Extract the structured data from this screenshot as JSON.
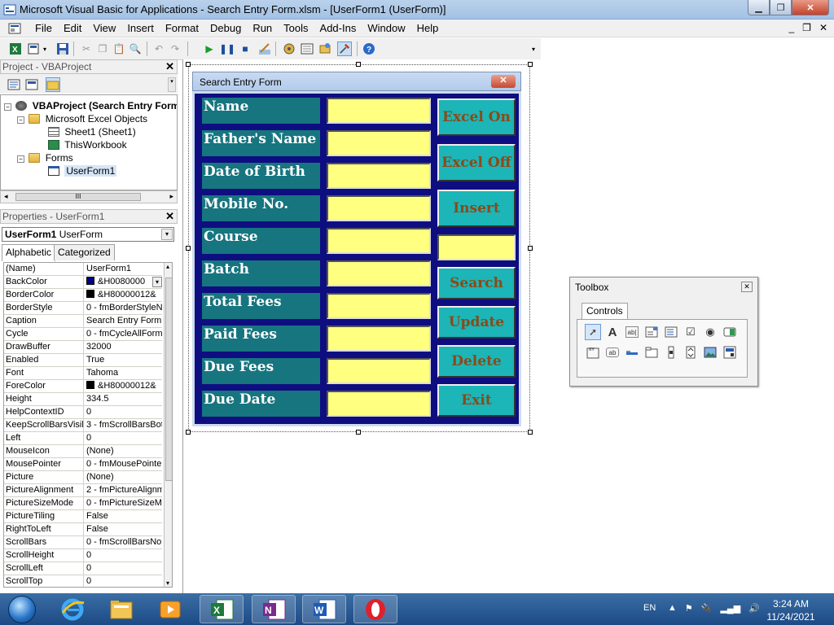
{
  "window": {
    "title": "Microsoft Visual Basic for Applications - Search Entry Form.xlsm - [UserForm1 (UserForm)]"
  },
  "menu": [
    "File",
    "Edit",
    "View",
    "Insert",
    "Format",
    "Debug",
    "Run",
    "Tools",
    "Add-Ins",
    "Window",
    "Help"
  ],
  "project_panel": {
    "title": "Project - VBAProject",
    "tree": {
      "root": "VBAProject (Search Entry Form",
      "excel_objects": "Microsoft Excel Objects",
      "sheet1": "Sheet1 (Sheet1)",
      "workbook": "ThisWorkbook",
      "forms": "Forms",
      "userform": "UserForm1"
    },
    "scroll_thumb": "III"
  },
  "properties_panel": {
    "title": "Properties - UserForm1",
    "object_name": "UserForm1",
    "object_type": "UserForm",
    "tabs": [
      "Alphabetic",
      "Categorized"
    ],
    "rows": [
      {
        "name": "(Name)",
        "value": "UserForm1"
      },
      {
        "name": "BackColor",
        "value": "&H0080000",
        "color": "#000080"
      },
      {
        "name": "BorderColor",
        "value": "&H80000012&",
        "color": "#000000"
      },
      {
        "name": "BorderStyle",
        "value": "0 - fmBorderStyleN"
      },
      {
        "name": "Caption",
        "value": "Search Entry Form"
      },
      {
        "name": "Cycle",
        "value": "0 - fmCycleAllForm"
      },
      {
        "name": "DrawBuffer",
        "value": "32000"
      },
      {
        "name": "Enabled",
        "value": "True"
      },
      {
        "name": "Font",
        "value": "Tahoma"
      },
      {
        "name": "ForeColor",
        "value": "&H80000012&",
        "color": "#000000"
      },
      {
        "name": "Height",
        "value": "334.5"
      },
      {
        "name": "HelpContextID",
        "value": "0"
      },
      {
        "name": "KeepScrollBarsVisible",
        "value": "3 - fmScrollBarsBot"
      },
      {
        "name": "Left",
        "value": "0"
      },
      {
        "name": "MouseIcon",
        "value": "(None)"
      },
      {
        "name": "MousePointer",
        "value": "0 - fmMousePointe"
      },
      {
        "name": "Picture",
        "value": "(None)"
      },
      {
        "name": "PictureAlignment",
        "value": "2 - fmPictureAlignm"
      },
      {
        "name": "PictureSizeMode",
        "value": "0 - fmPictureSizeM"
      },
      {
        "name": "PictureTiling",
        "value": "False"
      },
      {
        "name": "RightToLeft",
        "value": "False"
      },
      {
        "name": "ScrollBars",
        "value": "0 - fmScrollBarsNor"
      },
      {
        "name": "ScrollHeight",
        "value": "0"
      },
      {
        "name": "ScrollLeft",
        "value": "0"
      },
      {
        "name": "ScrollTop",
        "value": "0"
      }
    ]
  },
  "userform": {
    "caption": "Search Entry Form",
    "labels": [
      "Name",
      "Father's Name",
      "Date of Birth",
      "Mobile No.",
      "Course",
      "Batch",
      "Total Fees",
      "Paid Fees",
      "Due Fees",
      "Due Date"
    ],
    "buttons": [
      "Excel On",
      "Excel Off",
      "Insert",
      "Search",
      "Update",
      "Delete",
      "Exit"
    ],
    "colors": {
      "back": "#0e0e80",
      "label_bg": "#17757f",
      "textbox_bg": "#ffff80",
      "button_bg": "#1cb5b8",
      "button_text": "#8b4a16"
    }
  },
  "toolbox": {
    "title": "Toolbox",
    "tab": "Controls",
    "controls_row1": [
      "pointer-icon",
      "label-tool-icon",
      "textbox-tool-icon",
      "combobox-tool-icon",
      "listbox-tool-icon",
      "checkbox-tool-icon",
      "optionbutton-tool-icon",
      "togglebutton-tool-icon"
    ],
    "controls_row2": [
      "frame-tool-icon",
      "commandbutton-tool-icon",
      "tabstrip-tool-icon",
      "multipage-tool-icon",
      "scrollbar-tool-icon",
      "spinbutton-tool-icon",
      "image-tool-icon",
      "refedit-tool-icon"
    ]
  },
  "taskbar": {
    "lang": "EN",
    "time": "3:24 AM",
    "date": "11/24/2021"
  }
}
